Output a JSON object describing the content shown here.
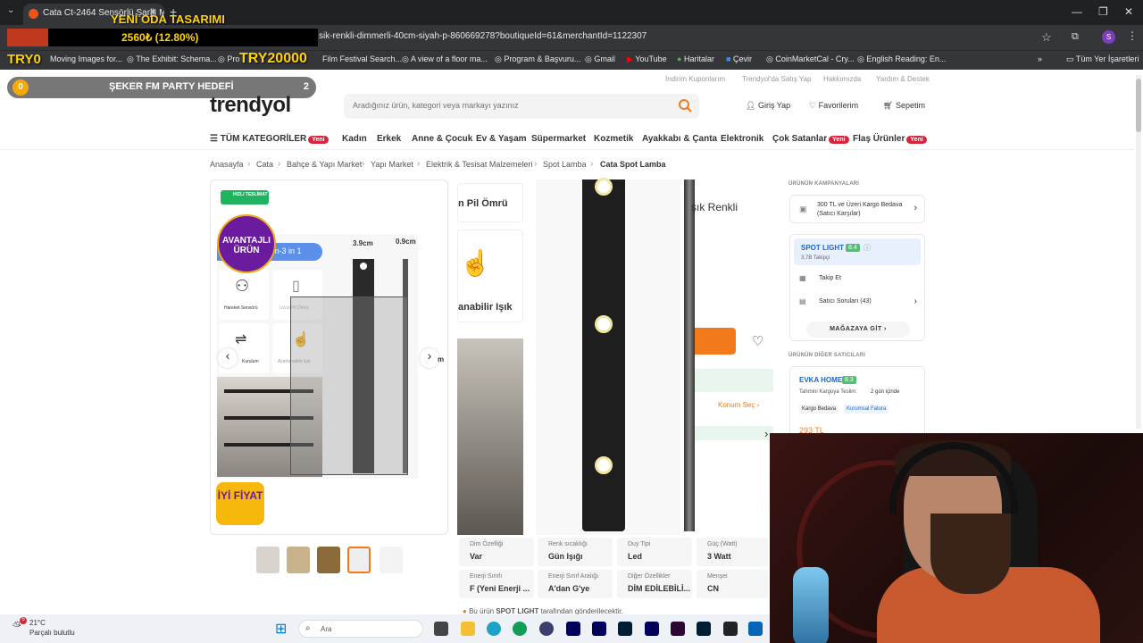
{
  "browser": {
    "tab_title": "Cata Ct-2464 Sensörlü Şarjlı M",
    "url": "sik-renkli-dimmerli-40cm-siyah-p-860669278?boutiqueId=61&merchantId=1122307",
    "bookmarks": [
      "Moving Images for...",
      "The Exhibit: Schema...",
      "Pro",
      "Film Festival Search...",
      "A view of a floor ma...",
      "Program & Başvuru...",
      "Gmail",
      "YouTube",
      "Haritalar",
      "Çevir",
      "CoinMarketCal - Cry...",
      "English Reading: En..."
    ],
    "all_bookmarks": "Tüm Yer İşaretleri"
  },
  "overlay": {
    "title": "YENİ ODA TASARIMI",
    "percent": "2560₺ (12.80%)",
    "try_left": "TRY0",
    "try_right": "TRY20000",
    "party_label": "ŞEKER FM PARTY HEDEFİ",
    "party_num": "0",
    "party_count": "2"
  },
  "site": {
    "top_links": [
      "İndirim Kuponlarım",
      "Trendyol'da Satış Yap",
      "Hakkımızda",
      "Yardım & Destek"
    ],
    "logo": "trendyol",
    "search_placeholder": "Aradığınız ürün, kategori veya markayı yazınız",
    "actions": {
      "login": "Giriş Yap",
      "favorites": "Favorilerim",
      "cart": "Sepetim"
    },
    "nav": {
      "all": "TÜM KATEGORİLER",
      "items": [
        "Kadın",
        "Erkek",
        "Anne & Çocuk",
        "Ev & Yaşam",
        "Süpermarket",
        "Kozmetik",
        "Ayakkabı & Çanta",
        "Elektronik",
        "Çok Satanlar",
        "Flaş Ürünler"
      ],
      "new_badge": "Yeni"
    },
    "breadcrumb": [
      "Anasayfa",
      "Cata",
      "Bahçe & Yapı Market",
      "Yapı Market",
      "Elektrik & Tesisat Malzemeleri",
      "Spot Lamba",
      "Cata Spot Lamba"
    ]
  },
  "gallery": {
    "fast": "HIZLI TESLİMAT",
    "advantage": "AVANTAJLI ÜRÜN",
    "good_price": "İYİ FİYAT",
    "pill": "m-3 in 1",
    "features": [
      "Hareket Sensörü",
      "Uzun Pil Ömrü",
      "Kurulum",
      "Ayarlanabilir Işık"
    ],
    "dim_width": "3.9cm",
    "dim_depth": "0.9cm",
    "side_label": "m"
  },
  "zoom": {
    "feature_a": "n Pil Ömrü",
    "feature_b": "anabilir Işık",
    "title_fragment": "şık Renkli",
    "location": "Konum Seç"
  },
  "attributes": [
    {
      "k": "Dim Özelliği",
      "v": "Var"
    },
    {
      "k": "Renk sıcaklığı",
      "v": "Gün Işığı"
    },
    {
      "k": "Duy Tipi",
      "v": "Led"
    },
    {
      "k": "Güç (Watt)",
      "v": "3 Watt"
    },
    {
      "k": "Enerji Sınıfı",
      "v": "F (Yeni Enerji ..."
    },
    {
      "k": "Enerji Sınıf Aralığı",
      "v": "A'dan G'ye"
    },
    {
      "k": "Diğer Özellikler",
      "v": "DİM EDİLEBİLİ..."
    },
    {
      "k": "Menşei",
      "v": "CN"
    }
  ],
  "seller_note": {
    "pre": "Bu ürün",
    "seller": "SPOT LIGHT",
    "post": "tarafından gönderilecektir."
  },
  "sidebar": {
    "campaigns_title": "ÜRÜNÜN KAMPANYALARI",
    "campaign": "300 TL ve Üzeri Kargo Bedava (Satıcı Karşılar)",
    "seller_name": "SPOT LIGHT",
    "seller_score": "8.4",
    "followers": "3,7B Takipçi",
    "follow": "Takip Et",
    "questions": "Satıcı Soruları (43)",
    "store": "MAĞAZAYA GİT",
    "other_title": "ÜRÜNÜN DİĞER SATICILARI",
    "other_name": "EVKA HOME",
    "other_score": "8.3",
    "delivery_label": "Tahmini Kargoya Teslim:",
    "delivery_value": "2 gün içinde",
    "tag1": "Kargo Bedava",
    "tag2": "Kurumsal Fatura",
    "price_partial": "293 TL"
  },
  "taskbar": {
    "temp": "21°C",
    "weather": "Parçalı bulutlu",
    "search": "Ara",
    "weather_badge": "5"
  }
}
